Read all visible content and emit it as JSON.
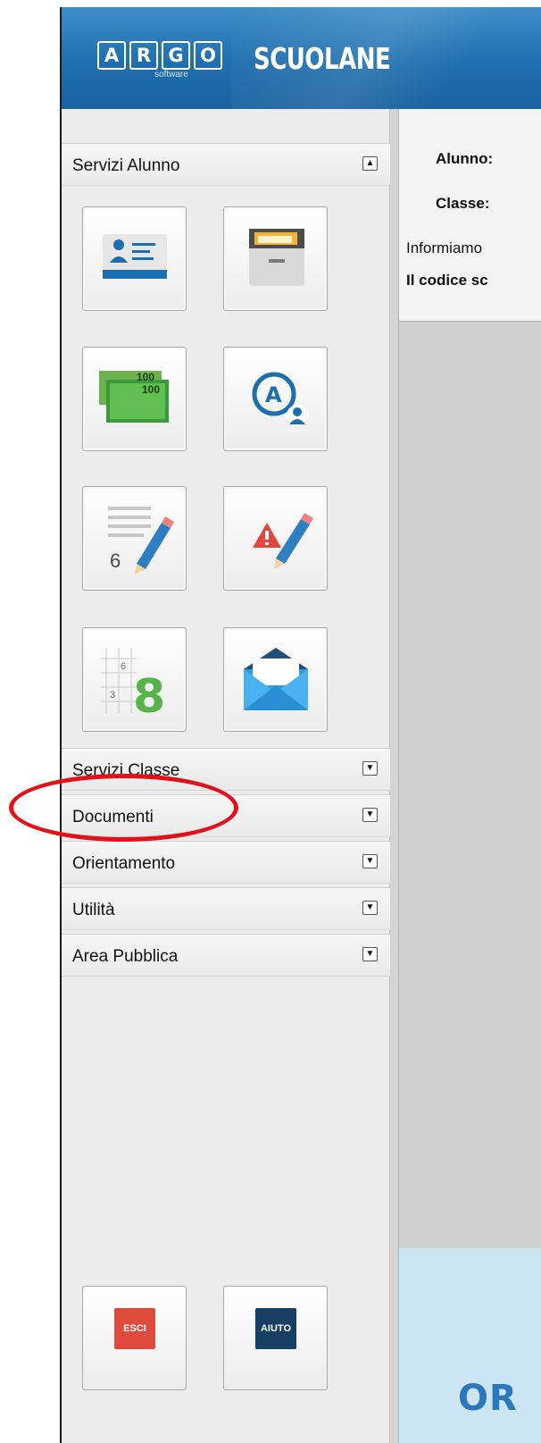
{
  "header": {
    "logo_letters": [
      "A",
      "R",
      "G",
      "O"
    ],
    "logo_subtitle": "software",
    "brand": "SCUOLANE"
  },
  "sidebar": {
    "sections": [
      {
        "label": "Servizi Alunno",
        "state": "expanded"
      },
      {
        "label": "Servizi Classe",
        "state": "collapsed"
      },
      {
        "label": "Documenti",
        "state": "collapsed"
      },
      {
        "label": "Orientamento",
        "state": "collapsed"
      },
      {
        "label": "Utilità",
        "state": "collapsed"
      },
      {
        "label": "Area Pubblica",
        "state": "collapsed"
      }
    ],
    "tiles": [
      {
        "icon": "id-card-icon"
      },
      {
        "icon": "file-cabinet-icon"
      },
      {
        "icon": "banknotes-icon",
        "note_value": "100"
      },
      {
        "icon": "account-icon",
        "letter": "A"
      },
      {
        "icon": "grade-notebook-icon",
        "digit": "6"
      },
      {
        "icon": "warning-pencil-icon"
      },
      {
        "icon": "grade-grid-icon",
        "digits": [
          "6",
          "3",
          "8"
        ]
      },
      {
        "icon": "envelope-icon"
      }
    ],
    "bottom_buttons": [
      {
        "label": "ESCI",
        "color": "#e04a3d"
      },
      {
        "label": "AIUTO",
        "color": "#173f63"
      }
    ]
  },
  "content": {
    "alunno_label": "Alunno:",
    "classe_label": "Classe:",
    "info_text": "Informiamo",
    "code_text": "Il codice sc",
    "banner_text": "OR"
  },
  "colors": {
    "header_blue": "#1f6fae",
    "highlight_ring": "#e3101a",
    "banner_bg": "#cce5f5"
  }
}
